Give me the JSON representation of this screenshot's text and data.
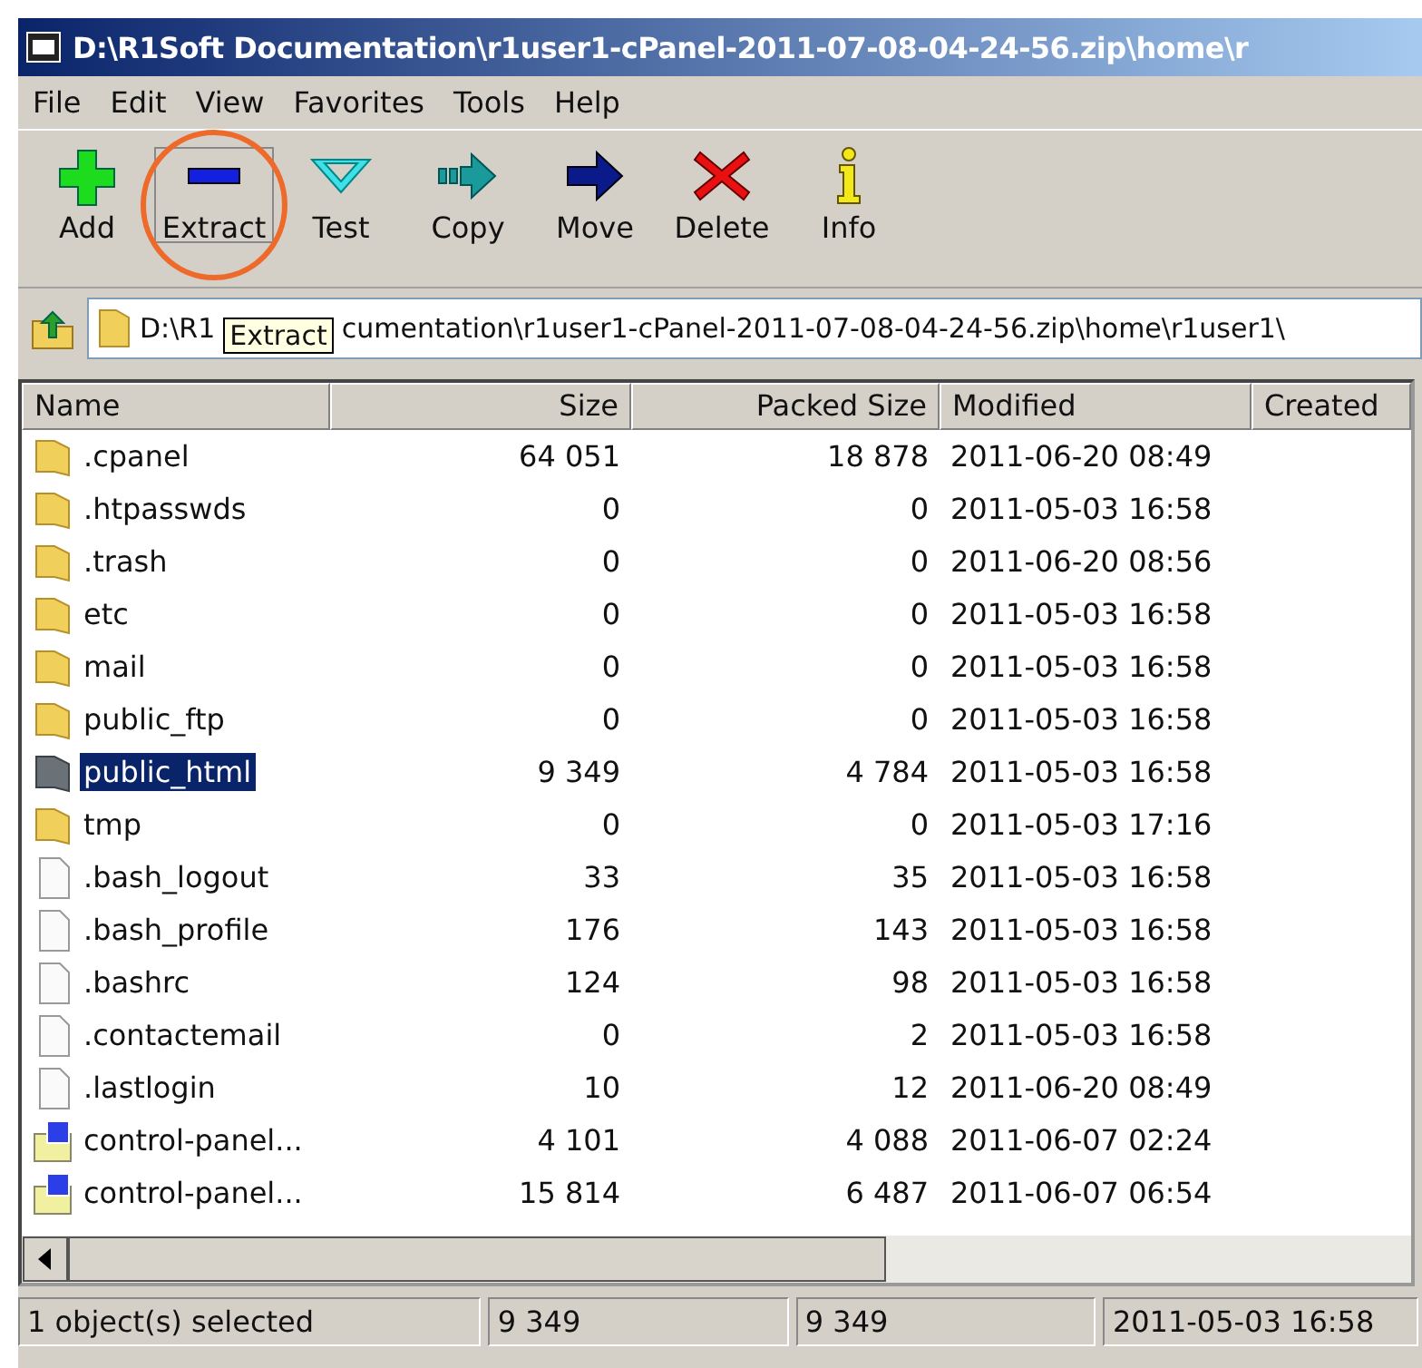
{
  "window": {
    "title": "D:\\R1Soft Documentation\\r1user1-cPanel-2011-07-08-04-24-56.zip\\home\\r"
  },
  "menu": [
    "File",
    "Edit",
    "View",
    "Favorites",
    "Tools",
    "Help"
  ],
  "toolbar": [
    {
      "kind": "add",
      "label": "Add",
      "highlighted": false
    },
    {
      "kind": "extract",
      "label": "Extract",
      "highlighted": true
    },
    {
      "kind": "test",
      "label": "Test",
      "highlighted": false
    },
    {
      "kind": "copy",
      "label": "Copy",
      "highlighted": false
    },
    {
      "kind": "move",
      "label": "Move",
      "highlighted": false
    },
    {
      "kind": "delete",
      "label": "Delete",
      "highlighted": false
    },
    {
      "kind": "info",
      "label": "Info",
      "highlighted": false
    }
  ],
  "address": {
    "path_before": "D:\\R1",
    "tooltip": "Extract",
    "path_after": "cumentation\\r1user1-cPanel-2011-07-08-04-24-56.zip\\home\\r1user1\\"
  },
  "table": {
    "columns": [
      "Name",
      "Size",
      "Packed Size",
      "Modified",
      "Created"
    ],
    "rows": [
      {
        "kind": "folder",
        "name": ".cpanel",
        "size": "64 051",
        "packed": "18 878",
        "modified": "2011-06-20 08:49",
        "selected": false
      },
      {
        "kind": "folder",
        "name": ".htpasswds",
        "size": "0",
        "packed": "0",
        "modified": "2011-05-03 16:58",
        "selected": false
      },
      {
        "kind": "folder",
        "name": ".trash",
        "size": "0",
        "packed": "0",
        "modified": "2011-06-20 08:56",
        "selected": false
      },
      {
        "kind": "folder",
        "name": "etc",
        "size": "0",
        "packed": "0",
        "modified": "2011-05-03 16:58",
        "selected": false
      },
      {
        "kind": "folder",
        "name": "mail",
        "size": "0",
        "packed": "0",
        "modified": "2011-05-03 16:58",
        "selected": false
      },
      {
        "kind": "folder",
        "name": "public_ftp",
        "size": "0",
        "packed": "0",
        "modified": "2011-05-03 16:58",
        "selected": false
      },
      {
        "kind": "folder",
        "name": "public_html",
        "size": "9 349",
        "packed": "4 784",
        "modified": "2011-05-03 16:58",
        "selected": true
      },
      {
        "kind": "folder",
        "name": "tmp",
        "size": "0",
        "packed": "0",
        "modified": "2011-05-03 17:16",
        "selected": false
      },
      {
        "kind": "file",
        "name": ".bash_logout",
        "size": "33",
        "packed": "35",
        "modified": "2011-05-03 16:58",
        "selected": false
      },
      {
        "kind": "file",
        "name": ".bash_profile",
        "size": "176",
        "packed": "143",
        "modified": "2011-05-03 16:58",
        "selected": false
      },
      {
        "kind": "file",
        "name": ".bashrc",
        "size": "124",
        "packed": "98",
        "modified": "2011-05-03 16:58",
        "selected": false
      },
      {
        "kind": "file",
        "name": ".contactemail",
        "size": "0",
        "packed": "2",
        "modified": "2011-05-03 16:58",
        "selected": false
      },
      {
        "kind": "file",
        "name": ".lastlogin",
        "size": "10",
        "packed": "12",
        "modified": "2011-06-20 08:49",
        "selected": false
      },
      {
        "kind": "archive",
        "name": "control-panel...",
        "size": "4 101",
        "packed": "4 088",
        "modified": "2011-06-07 02:24",
        "selected": false
      },
      {
        "kind": "archive",
        "name": "control-panel...",
        "size": "15 814",
        "packed": "6 487",
        "modified": "2011-06-07 06:54",
        "selected": false
      }
    ]
  },
  "status_bar": [
    "1 object(s) selected",
    "9 349",
    "9 349",
    "2011-05-03 16:58"
  ]
}
